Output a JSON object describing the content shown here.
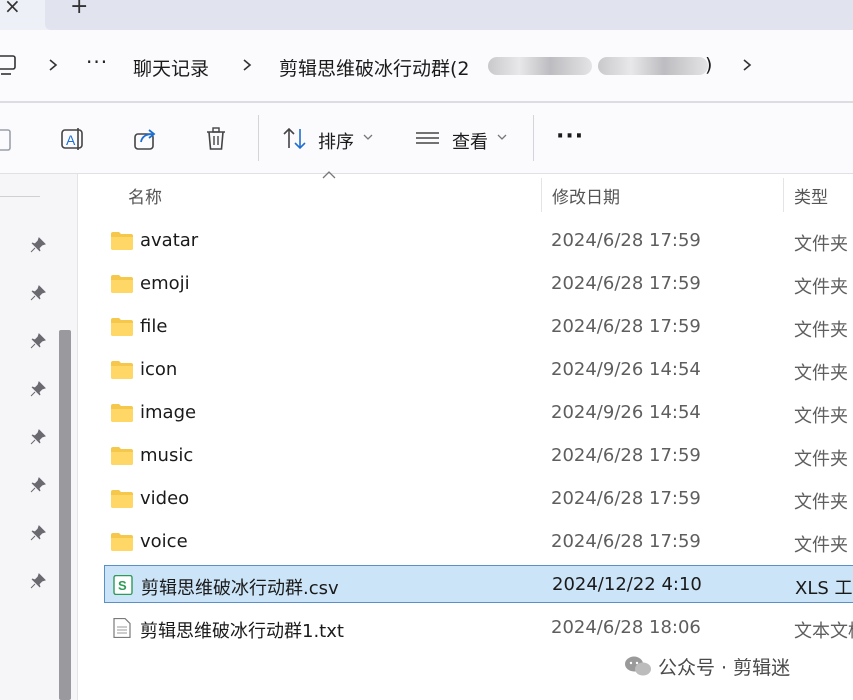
{
  "tabs": {
    "close_glyph": "×",
    "new_glyph": "+"
  },
  "breadcrumb": {
    "overflow": "···",
    "items": [
      {
        "label": "聊天记录"
      },
      {
        "label": "剪辑思维破冰行动群(2",
        "suffix": ")"
      }
    ]
  },
  "toolbar": {
    "sort_label": "排序",
    "view_label": "查看",
    "more_label": "···"
  },
  "columns": {
    "name": "名称",
    "modified": "修改日期",
    "type": "类型"
  },
  "files": [
    {
      "name": "avatar",
      "date": "2024/6/28 17:59",
      "type": "文件夹",
      "kind": "folder",
      "selected": false
    },
    {
      "name": "emoji",
      "date": "2024/6/28 17:59",
      "type": "文件夹",
      "kind": "folder",
      "selected": false
    },
    {
      "name": "file",
      "date": "2024/6/28 17:59",
      "type": "文件夹",
      "kind": "folder",
      "selected": false
    },
    {
      "name": "icon",
      "date": "2024/9/26 14:54",
      "type": "文件夹",
      "kind": "folder",
      "selected": false
    },
    {
      "name": "image",
      "date": "2024/9/26 14:54",
      "type": "文件夹",
      "kind": "folder",
      "selected": false
    },
    {
      "name": "music",
      "date": "2024/6/28 17:59",
      "type": "文件夹",
      "kind": "folder",
      "selected": false
    },
    {
      "name": "video",
      "date": "2024/6/28 17:59",
      "type": "文件夹",
      "kind": "folder",
      "selected": false
    },
    {
      "name": "voice",
      "date": "2024/6/28 17:59",
      "type": "文件夹",
      "kind": "folder",
      "selected": false
    },
    {
      "name": "剪辑思维破冰行动群.csv",
      "date": "2024/12/22 4:10",
      "type": "XLS 工作",
      "kind": "csv",
      "selected": true
    },
    {
      "name": "剪辑思维破冰行动群1.txt",
      "date": "2024/6/28 18:06",
      "type": "文本文档",
      "kind": "txt",
      "selected": false
    }
  ],
  "watermark": {
    "text": "公众号 · 剪辑迷"
  },
  "colors": {
    "folder": "#f5c84b",
    "selection_bg": "#cce4f7",
    "selection_border": "#5b8fc8",
    "accent": "#1f6fd1"
  }
}
